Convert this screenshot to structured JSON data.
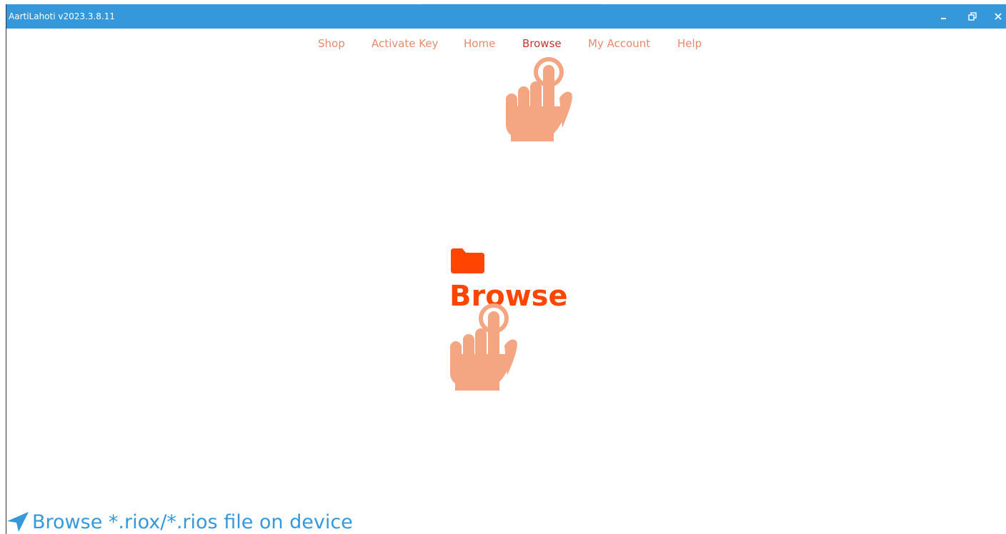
{
  "window": {
    "title": "AartiLahoti v2023.3.8.11",
    "minimize_icon": "minimize-icon",
    "maximize_icon": "restore-icon",
    "close_icon": "close-icon",
    "titlebar_color": "#3498db"
  },
  "nav": {
    "items": [
      {
        "label": "Shop"
      },
      {
        "label": "Activate Key"
      },
      {
        "label": "Home"
      },
      {
        "label": "Browse",
        "active": true
      },
      {
        "label": "My Account"
      },
      {
        "label": "Help"
      }
    ],
    "color": "#e8896c",
    "active_color": "#c0392b"
  },
  "main": {
    "browse_label": "Browse",
    "folder_icon": "folder-icon",
    "hand_icon": "tap-hand-icon",
    "accent_color": "#ff4500",
    "hand_color": "#f4a582"
  },
  "footer": {
    "text": "Browse *.riox/*.rios file on device",
    "icon": "location-arrow-icon",
    "color": "#3498db"
  }
}
